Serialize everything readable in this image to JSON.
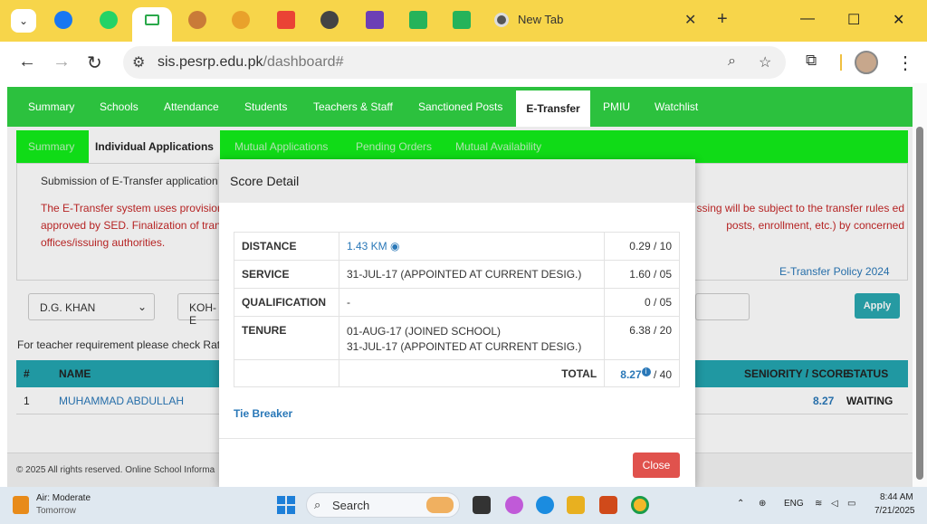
{
  "browser": {
    "tab_title": "New Tab",
    "url_host": "sis.pesrp.edu.pk",
    "url_path": "/dashboard#"
  },
  "site_nav": [
    "Summary",
    "Schools",
    "Attendance",
    "Students",
    "Teachers & Staff",
    "Sanctioned Posts",
    "E-Transfer",
    "PMIU",
    "Watchlist"
  ],
  "sub_nav": [
    "Summary",
    "Individual Applications",
    "Mutual Applications",
    "Pending Orders",
    "Mutual Availability"
  ],
  "info": {
    "title": "Submission of E-Transfer application",
    "red_left": "The E-Transfer system uses provision approved by SED. Finalization of tran offices/issuing authorities.",
    "red_right": "ssing will be subject to the transfer rules ed posts, enrollment, etc.) by concerned",
    "policy_link": "E-Transfer Policy 2024"
  },
  "filters": {
    "district": "D.G. KHAN",
    "tehsil": "KOH-E",
    "apply": "Apply"
  },
  "requirement_text": "For teacher requirement please check Rati",
  "table": {
    "headers": {
      "num": "#",
      "name": "NAME",
      "score": "SENIORITY / SCORE",
      "status": "STATUS"
    },
    "rows": [
      {
        "num": "1",
        "name": "MUHAMMAD ABDULLAH",
        "score": "8.27",
        "status": "WAITING"
      }
    ]
  },
  "footer": "© 2025 All rights reserved. Online School Informa",
  "modal": {
    "title": "Score Detail",
    "rows": [
      {
        "label": "DISTANCE",
        "value": "1.43 KM",
        "points": "0.29 / 10"
      },
      {
        "label": "SERVICE",
        "value": "31-JUL-17 (APPOINTED AT CURRENT DESIG.)",
        "points": "1.60 / 05"
      },
      {
        "label": "QUALIFICATION",
        "value": "-",
        "points": "0 / 05"
      },
      {
        "label": "TENURE",
        "value": "01-AUG-17 (JOINED SCHOOL)",
        "value2": "31-JUL-17 (APPOINTED AT CURRENT DESIG.)",
        "points": "6.38 / 20"
      }
    ],
    "total_label": "TOTAL",
    "total_value": "8.27",
    "total_max": "/ 40",
    "tie_breaker": "Tie Breaker",
    "close": "Close"
  },
  "taskbar": {
    "weather_line1": "Air: Moderate",
    "weather_line2": "Tomorrow",
    "search": "Search",
    "lang": "ENG",
    "time": "8:44 AM",
    "date": "7/21/2025"
  }
}
